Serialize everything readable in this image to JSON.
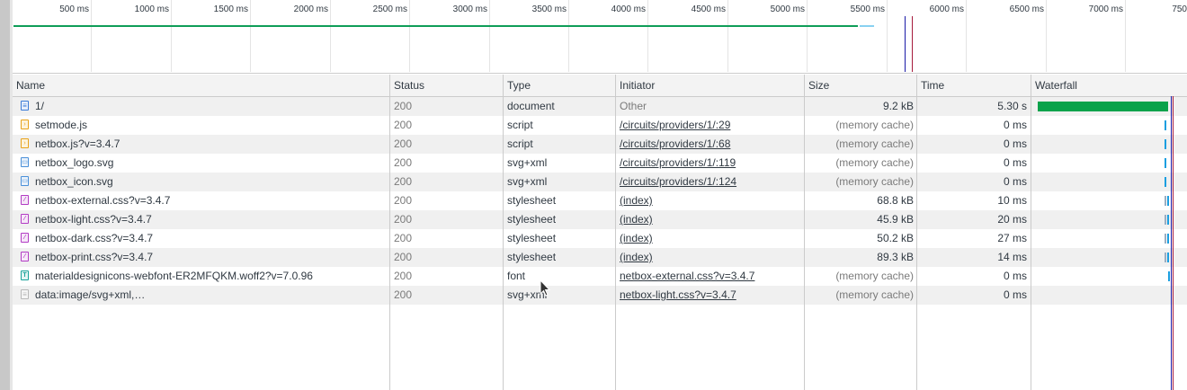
{
  "overview": {
    "ticks": [
      "500 ms",
      "1000 ms",
      "1500 ms",
      "2000 ms",
      "2500 ms",
      "3000 ms",
      "3500 ms",
      "4000 ms",
      "4500 ms",
      "5000 ms",
      "5500 ms",
      "6000 ms",
      "6500 ms",
      "7000 ms",
      "750"
    ]
  },
  "columns": {
    "name": "Name",
    "status": "Status",
    "type": "Type",
    "initiator": "Initiator",
    "size": "Size",
    "time": "Time",
    "waterfall": "Waterfall"
  },
  "requests": [
    {
      "name": "1/",
      "icon": "document-icon",
      "status": "200",
      "type": "document",
      "initiator": "Other",
      "initiator_link": false,
      "size": "9.2 kB",
      "time": "5.30 s"
    },
    {
      "name": "setmode.js",
      "icon": "script-icon",
      "status": "200",
      "type": "script",
      "initiator": "/circuits/providers/1/:29",
      "initiator_link": true,
      "size": "(memory cache)",
      "time": "0 ms"
    },
    {
      "name": "netbox.js?v=3.4.7",
      "icon": "script-icon",
      "status": "200",
      "type": "script",
      "initiator": "/circuits/providers/1/:68",
      "initiator_link": true,
      "size": "(memory cache)",
      "time": "0 ms"
    },
    {
      "name": "netbox_logo.svg",
      "icon": "image-icon",
      "status": "200",
      "type": "svg+xml",
      "initiator": "/circuits/providers/1/:119",
      "initiator_link": true,
      "size": "(memory cache)",
      "time": "0 ms"
    },
    {
      "name": "netbox_icon.svg",
      "icon": "image-icon",
      "status": "200",
      "type": "svg+xml",
      "initiator": "/circuits/providers/1/:124",
      "initiator_link": true,
      "size": "(memory cache)",
      "time": "0 ms"
    },
    {
      "name": "netbox-external.css?v=3.4.7",
      "icon": "stylesheet-icon",
      "status": "200",
      "type": "stylesheet",
      "initiator": "(index)",
      "initiator_link": true,
      "size": "68.8 kB",
      "time": "10 ms"
    },
    {
      "name": "netbox-light.css?v=3.4.7",
      "icon": "stylesheet-icon",
      "status": "200",
      "type": "stylesheet",
      "initiator": "(index)",
      "initiator_link": true,
      "size": "45.9 kB",
      "time": "20 ms"
    },
    {
      "name": "netbox-dark.css?v=3.4.7",
      "icon": "stylesheet-icon",
      "status": "200",
      "type": "stylesheet",
      "initiator": "(index)",
      "initiator_link": true,
      "size": "50.2 kB",
      "time": "27 ms"
    },
    {
      "name": "netbox-print.css?v=3.4.7",
      "icon": "stylesheet-icon",
      "status": "200",
      "type": "stylesheet",
      "initiator": "(index)",
      "initiator_link": true,
      "size": "89.3 kB",
      "time": "14 ms"
    },
    {
      "name": "materialdesignicons-webfont-ER2MFQKM.woff2?v=7.0.96",
      "icon": "font-icon",
      "status": "200",
      "type": "font",
      "initiator": "netbox-external.css?v=3.4.7",
      "initiator_link": true,
      "size": "(memory cache)",
      "time": "0 ms"
    },
    {
      "name": "data:image/svg+xml,…",
      "icon": "data-icon",
      "status": "200",
      "type": "svg+xml",
      "initiator": "netbox-light.css?v=3.4.7",
      "initiator_link": true,
      "size": "(memory cache)",
      "time": "0 ms"
    }
  ],
  "colors": {
    "waterfall_green": "#0aa24b",
    "waterfall_blue": "#1a9ee0",
    "dom_content_loaded_line": "#1a1aa6",
    "load_line": "#a61a3c"
  }
}
